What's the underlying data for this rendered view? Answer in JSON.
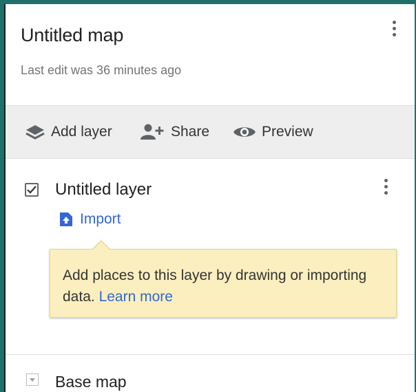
{
  "map": {
    "title": "Untitled map",
    "last_edit": "Last edit was 36 minutes ago"
  },
  "toolbar": {
    "add_layer": "Add layer",
    "share": "Share",
    "preview": "Preview"
  },
  "layer": {
    "name": "Untitled layer",
    "checked": true,
    "import_label": "Import"
  },
  "tooltip": {
    "text": "Add places to this layer by drawing or importing data.",
    "link": "Learn more"
  },
  "base_map": {
    "label": "Base map"
  },
  "icons": {
    "map_menu": "more-vert-icon",
    "add_layer": "layers-icon",
    "share": "person-add-icon",
    "preview": "eye-icon",
    "checkbox": "check-icon",
    "layer_menu": "more-vert-icon",
    "import": "upload-file-icon",
    "base_map_toggle": "chevron-down-icon"
  },
  "colors": {
    "background": "#1f6f6b",
    "link": "#3367d6",
    "toolbar": "#eeeeee",
    "tooltip": "#fcefbf"
  }
}
